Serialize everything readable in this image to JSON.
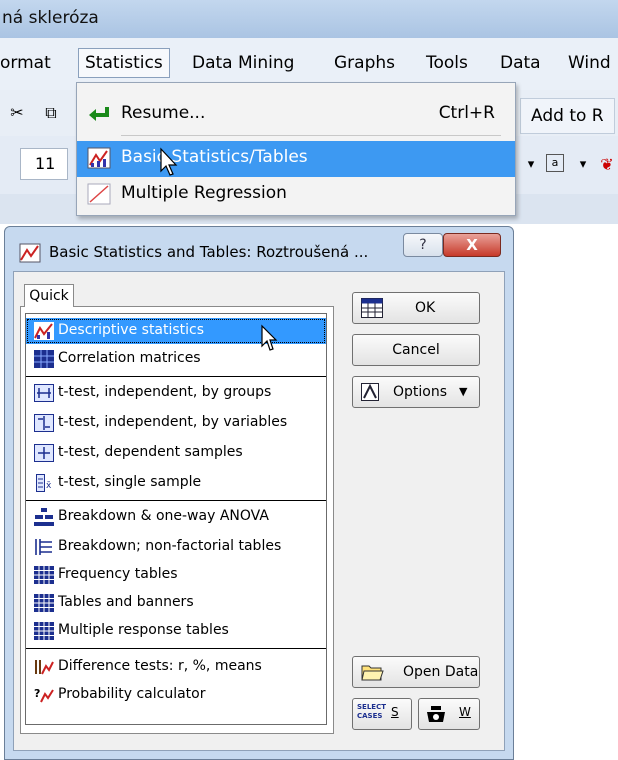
{
  "window": {
    "title_fragment": "ná skleróza"
  },
  "menubar": {
    "items": [
      {
        "label": "ormat",
        "underline": ""
      },
      {
        "label": "Statistics"
      },
      {
        "label": "Data Mining"
      },
      {
        "label": "Graphs"
      },
      {
        "label": "Tools"
      },
      {
        "label": "Data"
      },
      {
        "label": "Wind"
      }
    ]
  },
  "toolbar": {
    "font_size": "11",
    "add_to_label": "Add to R"
  },
  "statistics_menu": {
    "items": [
      {
        "label": "Resume...",
        "shortcut": "Ctrl+R",
        "icon": "resume-icon"
      },
      {
        "label": "Basic Statistics/Tables",
        "shortcut": "",
        "icon": "basic-stats-icon",
        "highlighted": true
      },
      {
        "label": "Multiple Regression",
        "shortcut": "",
        "icon": "regression-icon"
      }
    ]
  },
  "dialog": {
    "title": "Basic Statistics and Tables: Roztroušená ...",
    "help_label": "?",
    "close_label": "X",
    "tab_label": "Quick",
    "list_items": [
      {
        "label": "Descriptive statistics",
        "icon": "descriptive-icon",
        "selected": true
      },
      {
        "label": "Correlation matrices",
        "icon": "correlation-icon"
      },
      {
        "label": "t-test, independent, by groups",
        "icon": "ttest-groups-icon"
      },
      {
        "label": "t-test, independent, by variables",
        "icon": "ttest-variables-icon"
      },
      {
        "label": "t-test, dependent samples",
        "icon": "ttest-dependent-icon"
      },
      {
        "label": "t-test, single sample",
        "icon": "ttest-single-icon"
      },
      {
        "label": "Breakdown & one-way ANOVA",
        "icon": "breakdown-anova-icon"
      },
      {
        "label": "Breakdown; non-factorial tables",
        "icon": "breakdown-nonfactorial-icon"
      },
      {
        "label": "Frequency tables",
        "icon": "frequency-icon"
      },
      {
        "label": "Tables and banners",
        "icon": "tables-banners-icon"
      },
      {
        "label": "Multiple response tables",
        "icon": "multiple-response-icon"
      },
      {
        "label": "Difference tests: r, %, means",
        "icon": "difference-tests-icon"
      },
      {
        "label": "Probability calculator",
        "icon": "probability-icon"
      }
    ],
    "buttons": {
      "ok": "OK",
      "cancel": "Cancel",
      "options": "Options",
      "open_data": "Open Data",
      "select_cases_icon_text": "SELECT CASES",
      "select_cases_key": "S",
      "weight_key": "W"
    }
  },
  "colors": {
    "menu_highlight": "#3d99f2",
    "list_selection": "#3399ff",
    "dialog_frame": "#c6d9ef"
  }
}
